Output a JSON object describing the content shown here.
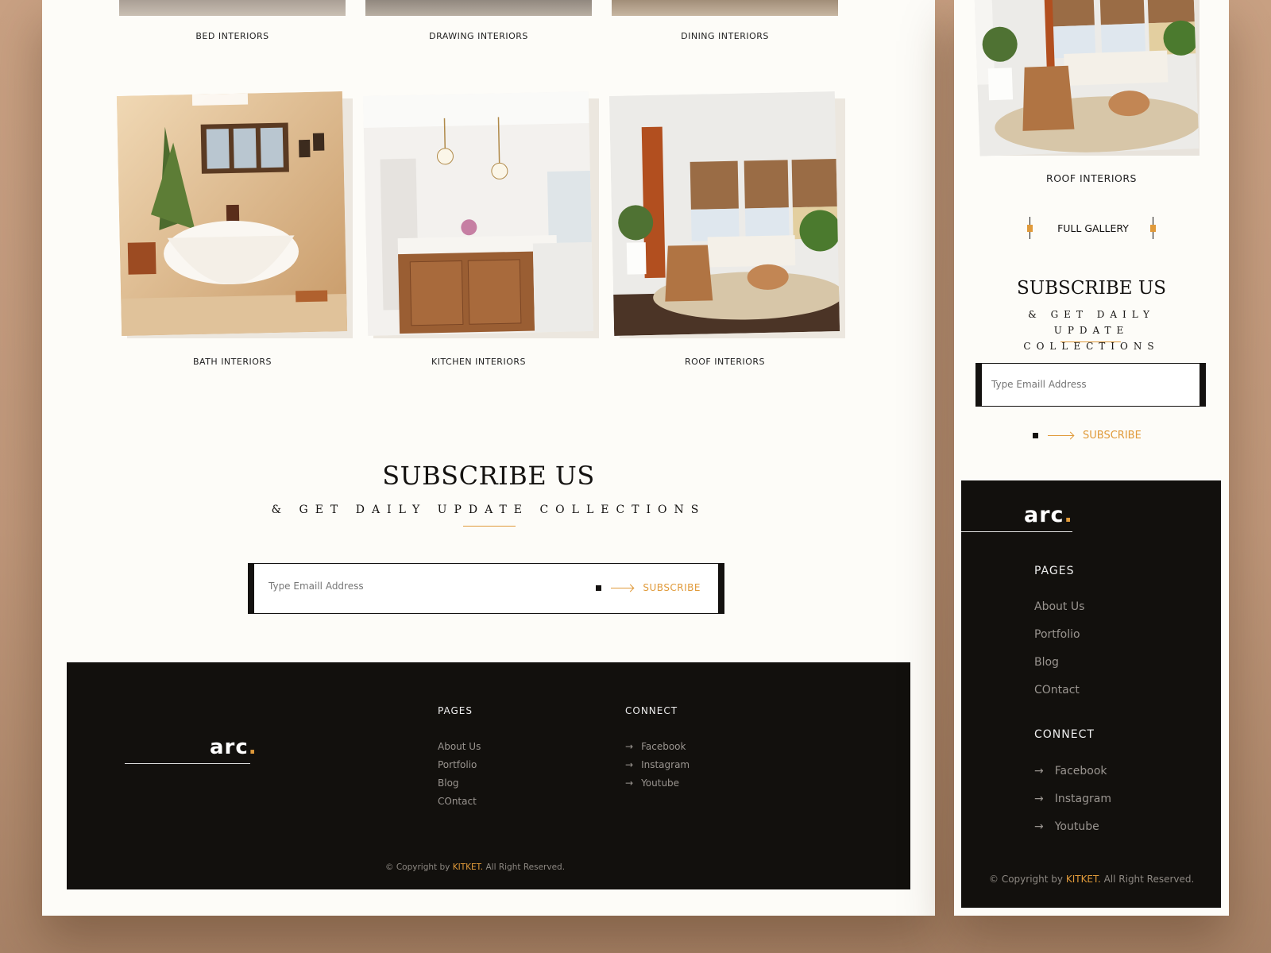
{
  "desktop": {
    "gallery_row1": [
      "BED INTERIORS",
      "DRAWING INTERIORS",
      "DINING INTERIORS"
    ],
    "gallery_row2": [
      "BATH INTERIORS",
      "KITCHEN INTERIORS",
      "ROOF INTERIORS"
    ],
    "subscribe": {
      "title": "SUBSCRIBE US",
      "subtitle": "& GET DAILY UPDATE COLLECTIONS",
      "placeholder": "Type Emaill Address",
      "button": "SUBSCRIBE"
    },
    "footer": {
      "logo": "arc",
      "logo_dot": ".",
      "pages_heading": "PAGES",
      "pages": [
        "About Us",
        "Portfolio",
        "Blog",
        "COntact"
      ],
      "connect_heading": "CONNECT",
      "connect": [
        "Facebook",
        "Instagram",
        "Youtube"
      ],
      "copyright_symbol": "©",
      "copyright_prefix": "Copyright by",
      "copyright_brand": "KITKET.",
      "copyright_suffix": "All Right Reserved."
    }
  },
  "mobile": {
    "gallery_caption": "ROOF INTERIORS",
    "gallery_button": "FULL GALLERY",
    "subscribe": {
      "title": "SUBSCRIBE US",
      "subtitle": "& GET DAILY UPDATE COLLECTIONS",
      "placeholder": "Type Emaill Address",
      "button": "SUBSCRIBE"
    },
    "footer": {
      "logo": "arc",
      "logo_dot": ".",
      "pages_heading": "PAGES",
      "pages": [
        "About Us",
        "Portfolio",
        "Blog",
        "COntact"
      ],
      "connect_heading": "CONNECT",
      "connect": [
        "Facebook",
        "Instagram",
        "Youtube"
      ],
      "copyright_symbol": "©",
      "copyright_prefix": "Copyright by",
      "copyright_brand": "KITKET.",
      "copyright_suffix": "All Right Reserved."
    }
  },
  "colors": {
    "accent": "#e09a3a",
    "dark": "#12100d",
    "page_bg": "#fdfcf8",
    "backdrop": "#c9a183"
  }
}
